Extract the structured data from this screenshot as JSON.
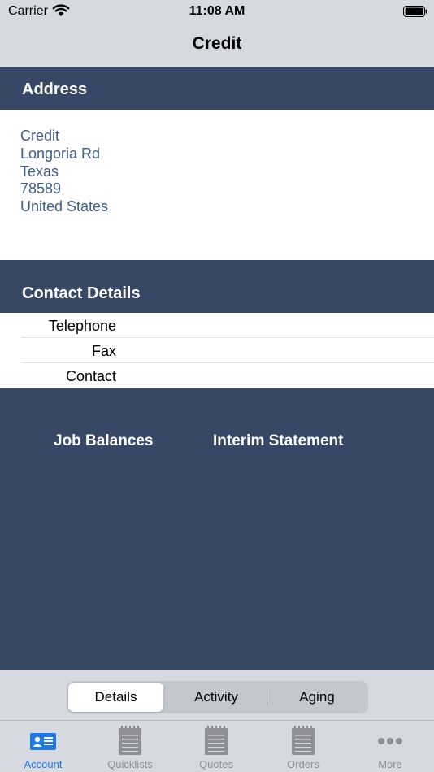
{
  "status_bar": {
    "carrier": "Carrier",
    "time": "11:08 AM"
  },
  "nav": {
    "title": "Credit"
  },
  "address": {
    "header": "Address",
    "lines": [
      "Credit",
      "Longoria Rd",
      "Texas",
      "78589",
      "United States"
    ]
  },
  "contact": {
    "header": "Contact Details",
    "rows": [
      {
        "label": "Telephone",
        "value": ""
      },
      {
        "label": "Fax",
        "value": ""
      },
      {
        "label": "Contact",
        "value": ""
      }
    ]
  },
  "panel": {
    "job_balances": "Job Balances",
    "interim_statement": "Interim Statement"
  },
  "segments": {
    "items": [
      "Details",
      "Activity",
      "Aging"
    ],
    "selected": "Details"
  },
  "tabs": {
    "items": [
      {
        "label": "Account",
        "icon": "account-card-icon",
        "active": true
      },
      {
        "label": "Quicklists",
        "icon": "notepad-icon",
        "active": false
      },
      {
        "label": "Quotes",
        "icon": "notepad-icon",
        "active": false
      },
      {
        "label": "Orders",
        "icon": "notepad-icon",
        "active": false
      },
      {
        "label": "More",
        "icon": "more-dots-icon",
        "active": false
      }
    ]
  },
  "colors": {
    "accent": "#1f7ae6",
    "header_bg": "#374866",
    "address_text": "#3f5c8a",
    "chrome_bg": "#d6dae0"
  }
}
